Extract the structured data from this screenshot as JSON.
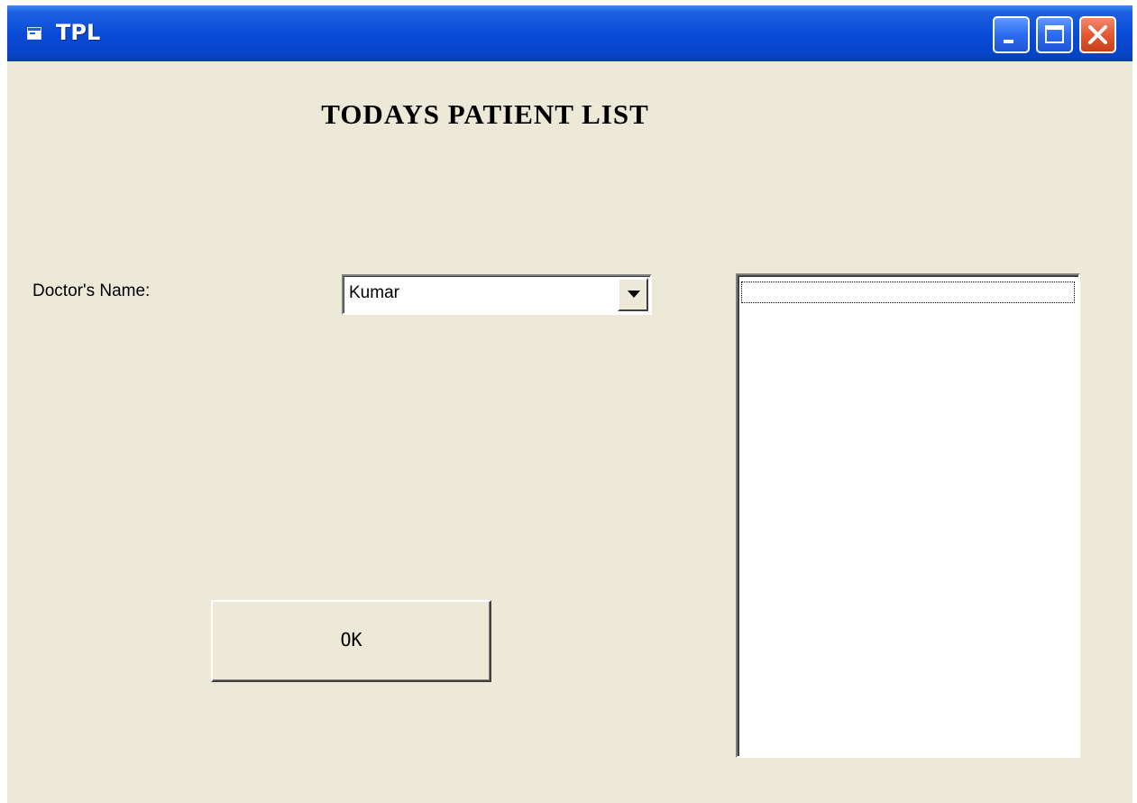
{
  "window": {
    "title": "TPL",
    "icon": "form-icon"
  },
  "form": {
    "heading": "TODAYS PATIENT LIST",
    "doctor_label": "Doctor's Name:",
    "doctor_select": {
      "value": "Kumar"
    },
    "patient_list": {
      "items": []
    },
    "ok_button": "OK"
  },
  "colors": {
    "window_bg": "#ECE9D8",
    "titlebar": "#0A4BD8",
    "close_button": "#E35A32"
  }
}
